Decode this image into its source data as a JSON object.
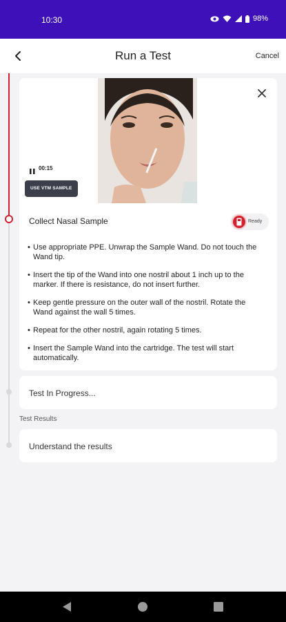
{
  "status_bar": {
    "time": "10:30",
    "battery": "98%",
    "icons": [
      "eye-icon",
      "wifi-icon",
      "signal-icon",
      "battery-icon"
    ]
  },
  "app_bar": {
    "back_icon": "chevron-left-icon",
    "title": "Run a Test",
    "cancel_label": "Cancel"
  },
  "video": {
    "close_icon": "close-icon",
    "pause_icon": "pause-icon",
    "elapsed": "00:15",
    "vtm_button": "USE VTM SAMPLE"
  },
  "current_step": {
    "title": "Collect Nasal Sample",
    "status_label": "Ready",
    "instructions": [
      "Use appropriate PPE. Unwrap the Sample Wand. Do not touch the Wand tip.",
      "Insert the tip of the Wand into one nostril about 1 inch up to the marker. If there is resistance, do not insert further.",
      "Keep gentle pressure on the outer wall of the nostril. Rotate the Wand against the wall 5 times.",
      "Repeat for the other nostril, again rotating 5 times.",
      "Insert the Sample Wand into the cartridge. The test will start automatically."
    ]
  },
  "progress_step": {
    "label": "Test In Progress..."
  },
  "results_section": {
    "heading": "Test Results",
    "item_label": "Understand the results"
  },
  "colors": {
    "status_bar": "#3d10b8",
    "accent": "#d2202e",
    "background": "#f3f3f5"
  }
}
